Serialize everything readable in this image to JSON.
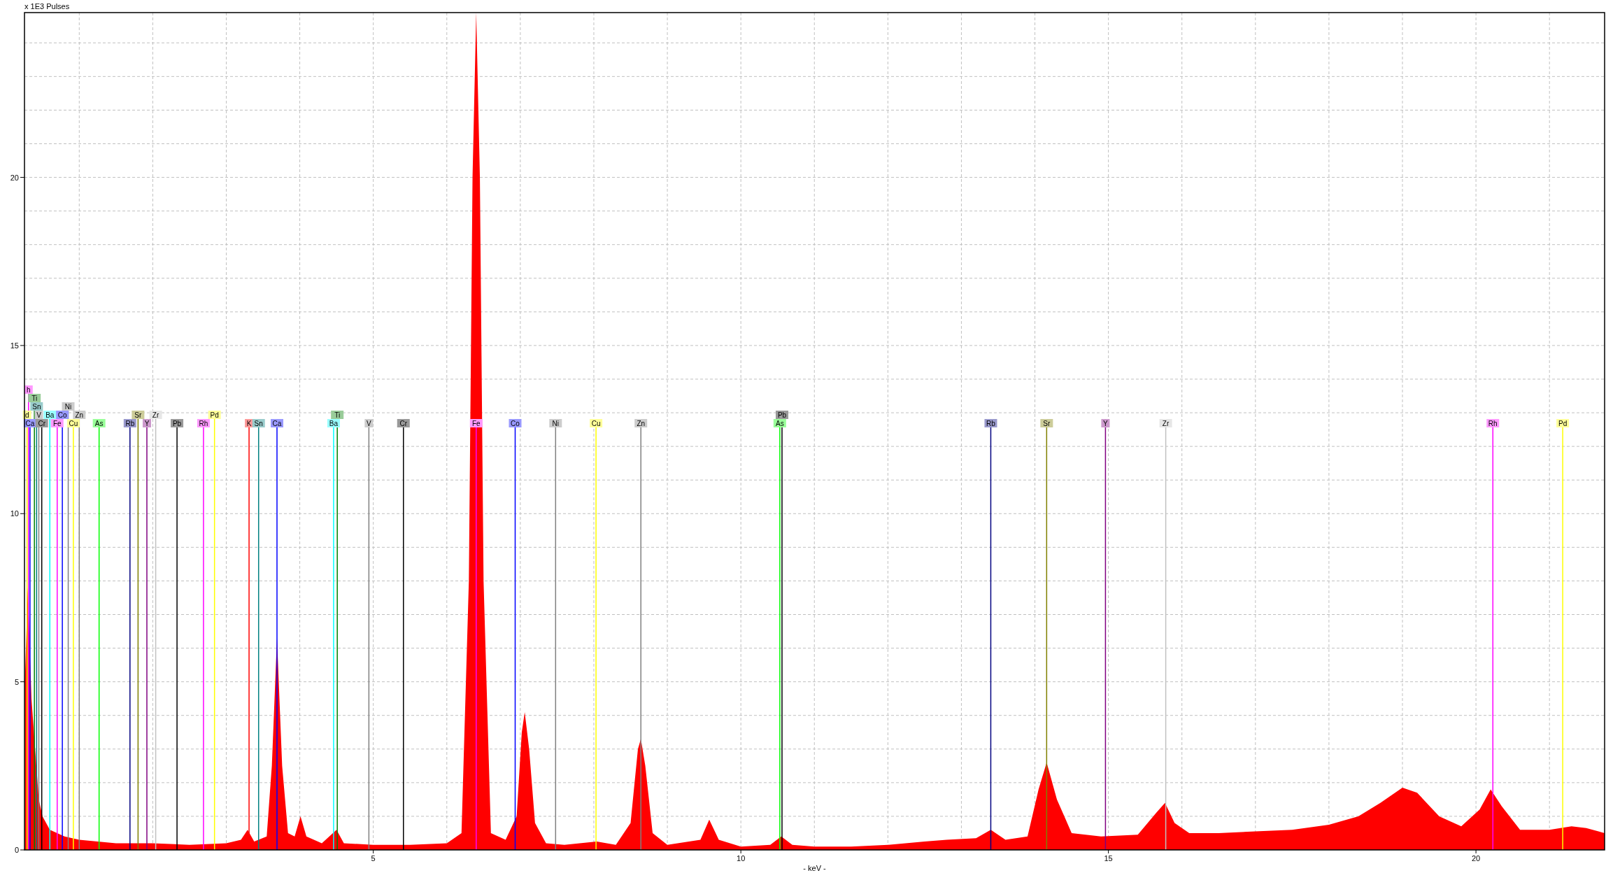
{
  "chart_data": {
    "type": "area",
    "xlabel": "- keV -",
    "ylabel": "x 1E3 Pulses",
    "xlim": [
      0.255,
      21.75
    ],
    "ylim": [
      0,
      24.9
    ],
    "xticks": [
      5,
      10,
      15,
      20
    ],
    "yticks": [
      0,
      5,
      10,
      15,
      20
    ],
    "grid": true,
    "x": [
      0.26,
      0.3,
      0.35,
      0.4,
      0.45,
      0.5,
      0.6,
      0.8,
      1.0,
      1.5,
      2.0,
      2.5,
      3.0,
      3.2,
      3.29,
      3.38,
      3.55,
      3.62,
      3.69,
      3.76,
      3.84,
      3.93,
      4.01,
      4.09,
      4.3,
      4.5,
      4.6,
      5.0,
      5.5,
      6.0,
      6.2,
      6.3,
      6.35,
      6.4,
      6.45,
      6.5,
      6.6,
      6.8,
      6.95,
      7.02,
      7.06,
      7.12,
      7.2,
      7.35,
      7.6,
      8.04,
      8.3,
      8.5,
      8.6,
      8.64,
      8.7,
      8.8,
      9.0,
      9.45,
      9.57,
      9.7,
      10.0,
      10.4,
      10.55,
      10.7,
      11.0,
      11.5,
      12.0,
      12.5,
      12.8,
      13.2,
      13.4,
      13.6,
      13.9,
      14.05,
      14.16,
      14.3,
      14.5,
      14.9,
      15.4,
      15.65,
      15.77,
      15.9,
      16.1,
      16.5,
      17.0,
      17.5,
      18.0,
      18.4,
      18.7,
      19.0,
      19.2,
      19.5,
      19.8,
      20.05,
      20.2,
      20.35,
      20.6,
      21.0,
      21.3,
      21.5,
      21.75
    ],
    "series": [
      {
        "color": "#ff0000",
        "values": [
          5,
          7.8,
          4.5,
          3.0,
          1.5,
          1.0,
          0.6,
          0.4,
          0.3,
          0.2,
          0.2,
          0.15,
          0.2,
          0.3,
          0.6,
          0.25,
          0.4,
          2.5,
          6.3,
          2.5,
          0.5,
          0.4,
          1.0,
          0.4,
          0.2,
          0.6,
          0.2,
          0.15,
          0.15,
          0.2,
          0.5,
          8.0,
          20,
          24.9,
          20,
          8.0,
          0.5,
          0.3,
          1.0,
          3.5,
          4.1,
          3.0,
          0.8,
          0.2,
          0.15,
          0.25,
          0.15,
          0.8,
          3.0,
          3.3,
          2.5,
          0.5,
          0.15,
          0.3,
          0.9,
          0.3,
          0.1,
          0.15,
          0.4,
          0.15,
          0.1,
          0.1,
          0.15,
          0.25,
          0.3,
          0.35,
          0.6,
          0.3,
          0.4,
          1.8,
          2.6,
          1.5,
          0.5,
          0.4,
          0.45,
          1.1,
          1.4,
          0.8,
          0.5,
          0.5,
          0.55,
          0.6,
          0.75,
          1.0,
          1.4,
          1.85,
          1.7,
          1.0,
          0.7,
          1.2,
          1.8,
          1.3,
          0.6,
          0.6,
          0.7,
          0.65,
          0.5
        ]
      }
    ],
    "ref_lines": [
      {
        "axis": "x",
        "label": "Ca",
        "value": 0.33,
        "color": "#0000ff"
      },
      {
        "axis": "x",
        "label": "Cr",
        "value": 0.49,
        "color": "#000000"
      },
      {
        "axis": "x",
        "label": "Fe",
        "value": 0.7,
        "color": "#ff00ff"
      },
      {
        "axis": "x",
        "label": "Cu",
        "value": 0.92,
        "color": "#ffff00"
      },
      {
        "axis": "x",
        "label": "V",
        "value": 0.45,
        "color": "#808080"
      },
      {
        "axis": "x",
        "label": "Ba",
        "value": 0.6,
        "color": "#00ffff"
      },
      {
        "axis": "x",
        "label": "Co",
        "value": 0.77,
        "color": "#0000ff"
      },
      {
        "axis": "x",
        "label": "Zn",
        "value": 1.0,
        "color": "#808080"
      },
      {
        "axis": "x",
        "label": "Sn",
        "value": 0.42,
        "color": "#008080"
      },
      {
        "axis": "x",
        "label": "d",
        "value": 0.29,
        "color": "#ffff00"
      },
      {
        "axis": "x",
        "label": "Ni",
        "value": 0.85,
        "color": "#808080"
      },
      {
        "axis": "x",
        "label": "Ti",
        "value": 0.39,
        "color": "#008000"
      },
      {
        "axis": "x",
        "label": "h",
        "value": 0.31,
        "color": "#ff00ff"
      },
      {
        "axis": "x",
        "label": "As",
        "value": 1.27,
        "color": "#00ff00"
      },
      {
        "axis": "x",
        "label": "Rb",
        "value": 1.69,
        "color": "#000080"
      },
      {
        "axis": "x",
        "label": "Sr",
        "value": 1.8,
        "color": "#808000"
      },
      {
        "axis": "x",
        "label": "Y",
        "value": 1.92,
        "color": "#800080"
      },
      {
        "axis": "x",
        "label": "Zr",
        "value": 2.04,
        "color": "#c0c0c0"
      },
      {
        "axis": "x",
        "label": "Pb",
        "value": 2.33,
        "color": "#000000"
      },
      {
        "axis": "x",
        "label": "Rh",
        "value": 2.69,
        "color": "#ff00ff"
      },
      {
        "axis": "x",
        "label": "Pd",
        "value": 2.84,
        "color": "#ffff00"
      },
      {
        "axis": "x",
        "label": "K",
        "value": 3.31,
        "color": "#ff0000"
      },
      {
        "axis": "x",
        "label": "Sn",
        "value": 3.44,
        "color": "#008080"
      },
      {
        "axis": "x",
        "label": "Ca",
        "value": 3.69,
        "color": "#0000ff"
      },
      {
        "axis": "x",
        "label": "Ba",
        "value": 4.46,
        "color": "#00ffff"
      },
      {
        "axis": "x",
        "label": "Ti",
        "value": 4.51,
        "color": "#008000"
      },
      {
        "axis": "x",
        "label": "V",
        "value": 4.94,
        "color": "#808080"
      },
      {
        "axis": "x",
        "label": "Cr",
        "value": 5.41,
        "color": "#000000"
      },
      {
        "axis": "x",
        "label": "Fe",
        "value": 6.4,
        "color": "#ff00ff"
      },
      {
        "axis": "x",
        "label": "Co",
        "value": 6.93,
        "color": "#0000ff"
      },
      {
        "axis": "x",
        "label": "Ni",
        "value": 7.48,
        "color": "#808080"
      },
      {
        "axis": "x",
        "label": "Cu",
        "value": 8.03,
        "color": "#ffff00"
      },
      {
        "axis": "x",
        "label": "Zn",
        "value": 8.64,
        "color": "#808080"
      },
      {
        "axis": "x",
        "label": "As",
        "value": 10.53,
        "color": "#00ff00"
      },
      {
        "axis": "x",
        "label": "Pb",
        "value": 10.56,
        "color": "#000000"
      },
      {
        "axis": "x",
        "label": "Rb",
        "value": 13.4,
        "color": "#000080"
      },
      {
        "axis": "x",
        "label": "Sr",
        "value": 14.16,
        "color": "#808000"
      },
      {
        "axis": "x",
        "label": "Y",
        "value": 14.96,
        "color": "#800080"
      },
      {
        "axis": "x",
        "label": "Zr",
        "value": 15.78,
        "color": "#c0c0c0"
      },
      {
        "axis": "x",
        "label": "Rh",
        "value": 20.23,
        "color": "#ff00ff"
      },
      {
        "axis": "x",
        "label": "Pd",
        "value": 21.18,
        "color": "#ffff00"
      }
    ]
  }
}
